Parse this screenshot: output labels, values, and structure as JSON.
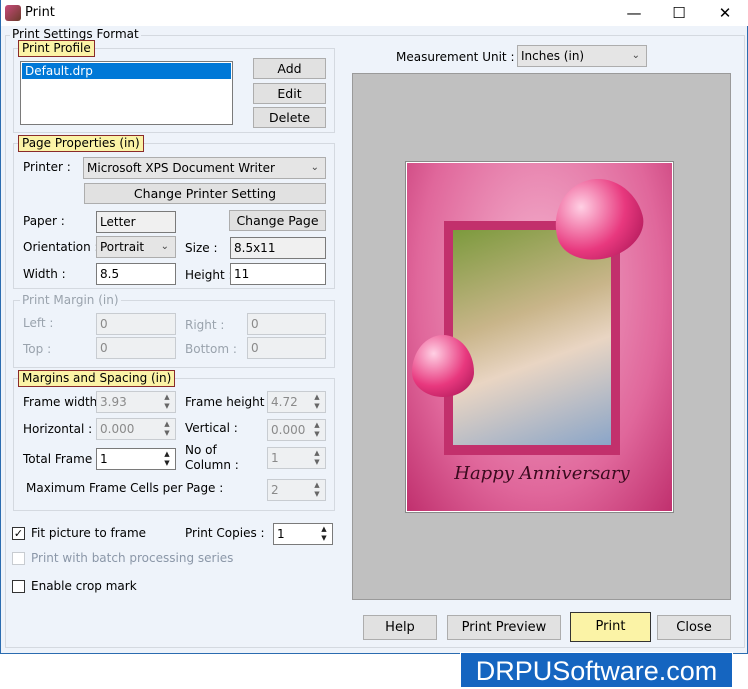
{
  "window": {
    "title": "Print",
    "minimize": "—",
    "maximize": "☐",
    "close": "✕"
  },
  "settings_title": "Print Settings Format",
  "profile": {
    "legend": "Print Profile",
    "items": [
      "Default.drp"
    ],
    "add": "Add",
    "edit": "Edit",
    "delete": "Delete"
  },
  "page": {
    "legend": "Page Properties  (in)",
    "printer_label": "Printer :",
    "printer": "Microsoft XPS Document Writer",
    "change_printer": "Change Printer Setting",
    "paper_label": "Paper :",
    "paper": "Letter",
    "change_page": "Change Page",
    "orientation_label": "Orientation :",
    "orientation": "Portrait",
    "size_label": "Size :",
    "size": "8.5x11",
    "width_label": "Width :",
    "width": "8.5",
    "height_label": "Height :",
    "height": "11"
  },
  "margin": {
    "legend": "Print Margin (in)",
    "left_label": "Left :",
    "left": "0",
    "right_label": "Right :",
    "right": "0",
    "top_label": "Top :",
    "top": "0",
    "bottom_label": "Bottom :",
    "bottom": "0"
  },
  "spacing": {
    "legend": "Margins and Spacing  (in)",
    "frame_width_label": "Frame width",
    "frame_width": "3.93",
    "frame_height_label": "Frame height :",
    "frame_height": "4.72",
    "horizontal_label": "Horizontal :",
    "horizontal": "0.000",
    "vertical_label": "Vertical :",
    "vertical": "0.000",
    "total_frame_label": "Total Frame",
    "total_frame": "1",
    "columns_label_1": "No of",
    "columns_label_2": "Column :",
    "columns": "1",
    "max_cells_label": "Maximum Frame Cells per Page :",
    "max_cells": "2"
  },
  "options": {
    "fit_label": "Fit picture to frame",
    "fit_checked": true,
    "batch_label": "Print with batch processing series",
    "batch_checked": false,
    "crop_label": "Enable crop mark",
    "crop_checked": false,
    "copies_label": "Print Copies :",
    "copies": "1"
  },
  "preview": {
    "unit_label": "Measurement Unit :",
    "unit": "Inches (in)",
    "card_text": "Happy Anniversary"
  },
  "buttons": {
    "help": "Help",
    "print_preview": "Print Preview",
    "print": "Print",
    "close": "Close"
  },
  "watermark": "DRPUSoftware.com",
  "colors": {
    "accent": "#0078d7",
    "legend_bg": "#fbf3a6",
    "preview_bg": "#c0c0c0",
    "watermark_bg": "#1565c0"
  }
}
